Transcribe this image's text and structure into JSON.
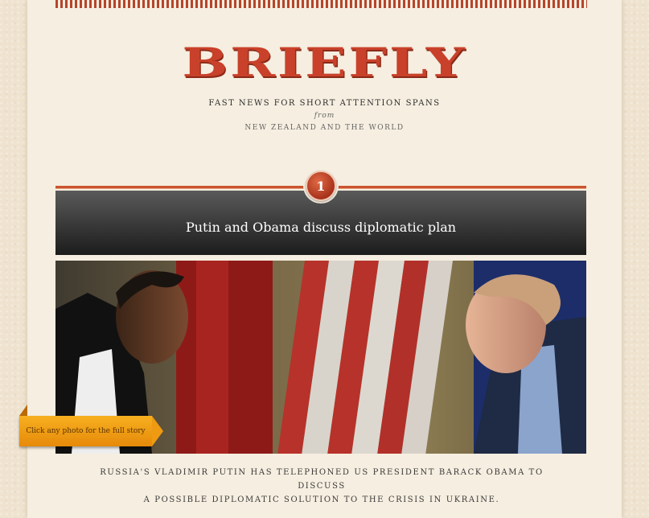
{
  "site": {
    "logo": "BRIEFLY",
    "tagline": "FAST NEWS FOR SHORT ATTENTION SPANS",
    "tagline_from": "from",
    "tagline_region": "NEW ZEALAND AND THE WORLD"
  },
  "story": {
    "number": "1",
    "headline": "Putin and Obama discuss diplomatic plan",
    "photo_tip": "Click any photo for the full story",
    "summary_line1": "RUSSIA'S VLADIMIR PUTIN HAS TELEPHONED US PRESIDENT BARACK OBAMA TO DISCUSS",
    "summary_line2": "A POSSIBLE DIPLOMATIC SOLUTION TO THE CRISIS IN UKRAINE."
  },
  "colors": {
    "brand_red": "#c9412a",
    "ribbon_orange": "#f2a016",
    "headline_bar": "#2a2a2a"
  }
}
